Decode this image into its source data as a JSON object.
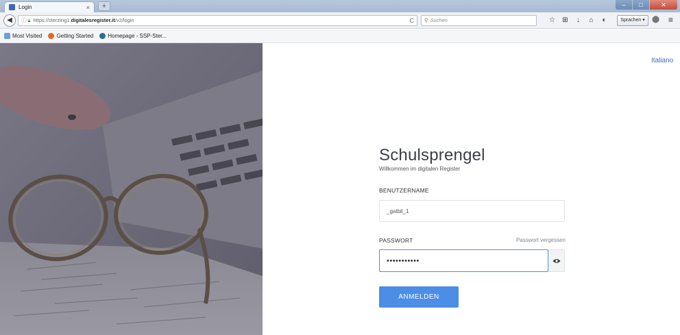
{
  "browser": {
    "tab_title": "Login",
    "tab_close": "×",
    "new_tab": "+",
    "window_controls": {
      "minimize": "–",
      "maximize": "□",
      "close": "✕"
    },
    "url_prefix": "https://sterzing1.",
    "url_domain": "digitalesregister.it",
    "url_path": "/v2/login",
    "reload": "C",
    "search_placeholder": "Suchen",
    "language_button": "Sprachen ▾",
    "menu": "≡",
    "toolbar_icons": [
      "☆",
      "⊞",
      "↓",
      "⌂",
      "◐"
    ]
  },
  "bookmarks": [
    {
      "label": "Most Visited"
    },
    {
      "label": "Getting Started"
    },
    {
      "label": "Homepage - SSP-Ster..."
    }
  ],
  "page": {
    "language_link": "Italiano",
    "brand_title": "Schulsprengel",
    "subtitle": "Willkommen im digitalen Register",
    "username_label": "BENUTZERNAME",
    "username_value": "_gatbil_1",
    "password_label": "PASSWORT",
    "forgot_link": "Passwort vergessen",
    "password_value": "•••••••••••",
    "show_password_icon": "eye-icon",
    "submit_label": "ANMELDEN"
  },
  "colors": {
    "accent": "#4c8de6",
    "link": "#3b6fb6",
    "hero_overlay": "#6f6d7b"
  }
}
